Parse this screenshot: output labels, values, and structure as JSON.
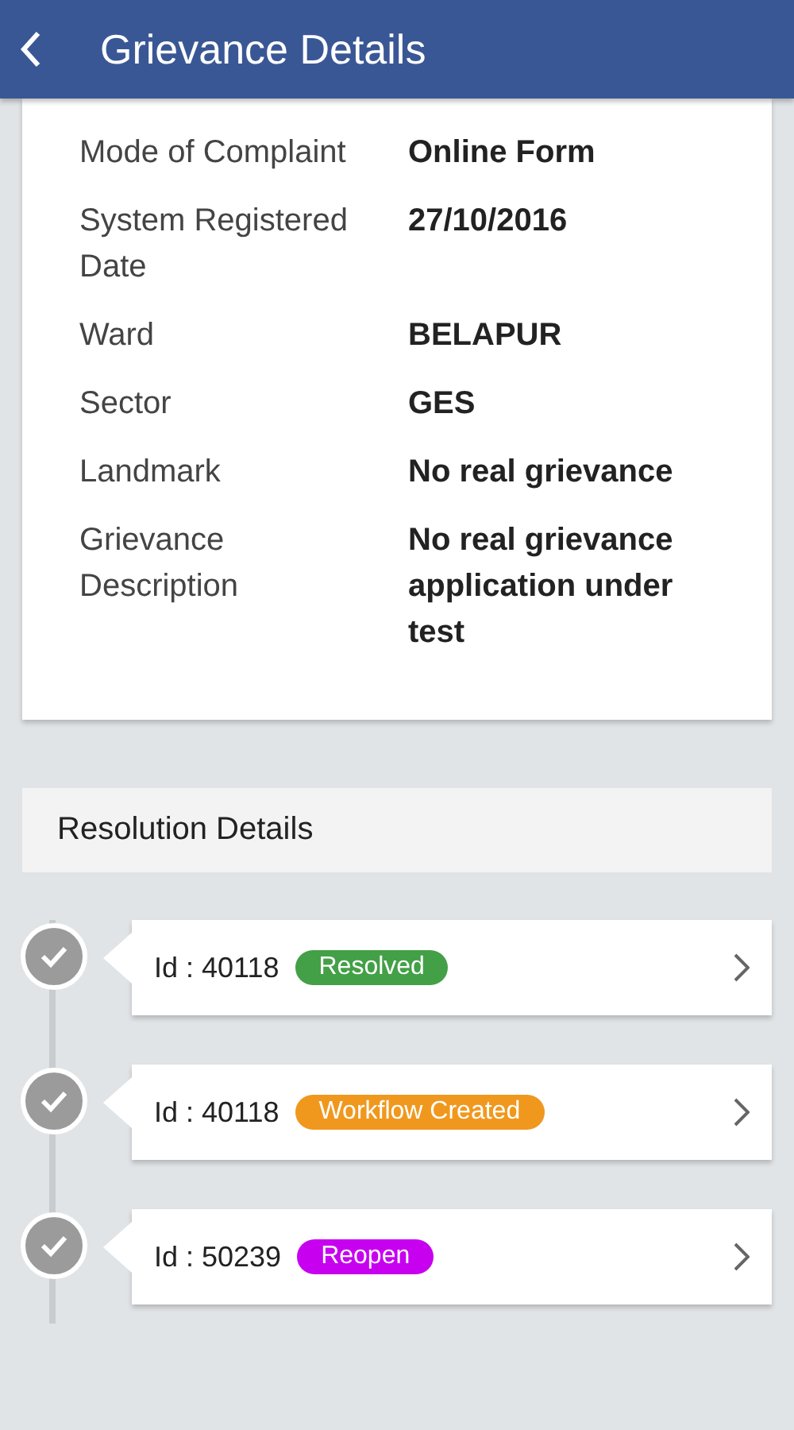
{
  "header": {
    "title": "Grievance Details"
  },
  "details": [
    {
      "label": "Mode of Complaint",
      "value": "Online Form"
    },
    {
      "label": "System Registered Date",
      "value": "27/10/2016"
    },
    {
      "label": "Ward",
      "value": "BELAPUR"
    },
    {
      "label": "Sector",
      "value": "GES"
    },
    {
      "label": "Landmark",
      "value": "No real grievance"
    },
    {
      "label": "Grievance Description",
      "value": "No real grievance application under test"
    }
  ],
  "resolution": {
    "title": "Resolution Details",
    "items": [
      {
        "id": "Id : 40118",
        "status": "Resolved",
        "color": "#43a047"
      },
      {
        "id": "Id : 40118",
        "status": "Workflow Created",
        "color": "#f0981e"
      },
      {
        "id": "Id : 50239",
        "status": "Reopen",
        "color": "#c700f0"
      }
    ]
  }
}
